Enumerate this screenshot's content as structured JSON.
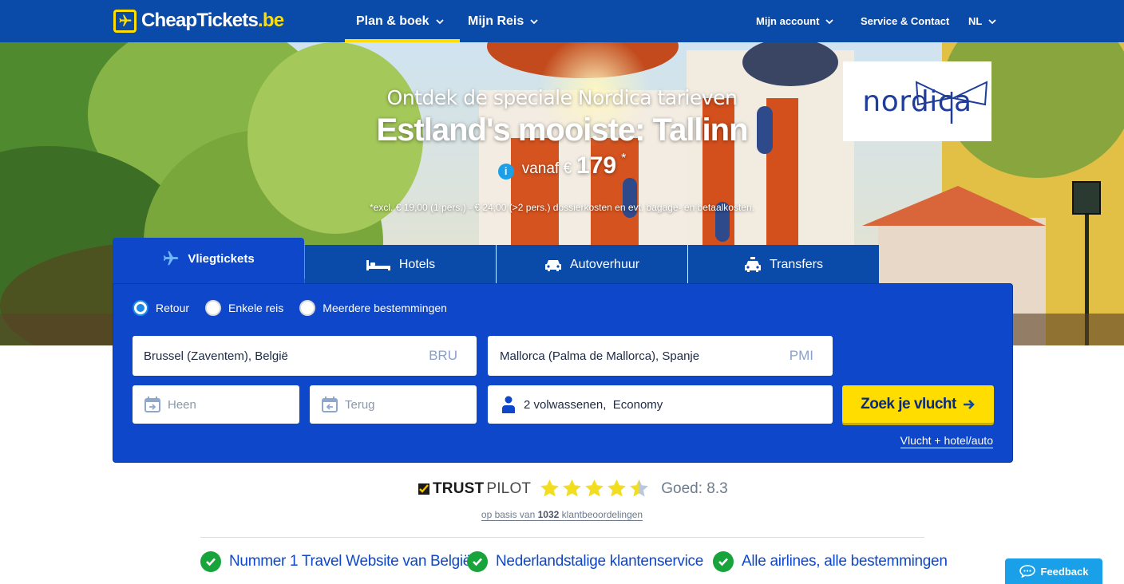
{
  "header": {
    "logo_text": "CheapTickets",
    "logo_tld": ".be",
    "nav": [
      {
        "label": "Plan & boek",
        "active": true
      },
      {
        "label": "Mijn Reis",
        "active": false
      }
    ],
    "right": {
      "account": "Mijn account",
      "service": "Service & Contact",
      "language": "NL"
    }
  },
  "hero": {
    "subtitle": "Ontdek de speciale Nordica tarieven",
    "title": "Estland's mooiste: Tallinn",
    "info_symbol": "i",
    "price_prefix": "vanaf €",
    "price": "179",
    "price_marker": "*",
    "disclaimer": "*excl. € 19,00 (1 pers.) - € 24,00 (>2 pers.) dossierkosten en evt. bagage- en betaalkosten.",
    "partner": "nordica"
  },
  "tabs": [
    {
      "label": "Vliegtickets",
      "icon": "plane-icon",
      "active": true
    },
    {
      "label": "Hotels",
      "icon": "bed-icon",
      "active": false
    },
    {
      "label": "Autoverhuur",
      "icon": "car-icon",
      "active": false
    },
    {
      "label": "Transfers",
      "icon": "taxi-icon",
      "active": false
    }
  ],
  "search": {
    "trip_types": [
      {
        "label": "Retour",
        "checked": true
      },
      {
        "label": "Enkele reis",
        "checked": false
      },
      {
        "label": "Meerdere bestemmingen",
        "checked": false
      }
    ],
    "origin": {
      "value": "Brussel (Zaventem), België",
      "code": "BRU"
    },
    "destination": {
      "value": "Mallorca (Palma de Mallorca), Spanje",
      "code": "PMI"
    },
    "depart_placeholder": "Heen",
    "return_placeholder": "Terug",
    "passengers": "2 volwassenen,",
    "cabin": "Economy",
    "submit": "Zoek je vlucht",
    "combo_link": "Vlucht + hotel/auto"
  },
  "trustpilot": {
    "brand_bold": "TRUST",
    "brand_light": "PILOT",
    "stars": 4.5,
    "score_text": "Goed: 8.3",
    "reviews_prefix": "op basis van",
    "reviews_count": "1032",
    "reviews_suffix": "klantbeoordelingen"
  },
  "usps": [
    "Nummer 1 Travel Website van België",
    "Nederlandstalige klantenservice",
    "Alle airlines, alle bestemmingen"
  ],
  "feedback": "Feedback",
  "colors": {
    "brand_blue": "#0a4aa8",
    "panel_blue": "#0e47c9",
    "accent_yellow": "#ffdd00",
    "success_green": "#19a33b"
  }
}
